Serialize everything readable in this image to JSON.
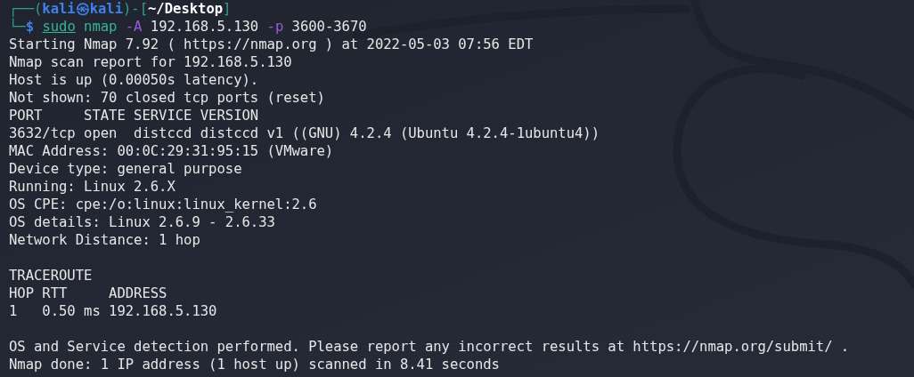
{
  "prompt": {
    "line1": [
      {
        "text": "┌──(",
        "kind": "frame"
      },
      {
        "text": "kali㉿kali",
        "kind": "user"
      },
      {
        "text": ")-[",
        "kind": "frame"
      },
      {
        "text": "~/Desktop",
        "kind": "path"
      },
      {
        "text": "]",
        "kind": "frame"
      }
    ],
    "line2": [
      {
        "text": "└─",
        "kind": "frame"
      },
      {
        "text": "$",
        "kind": "user"
      }
    ]
  },
  "command": [
    {
      "text": "sudo",
      "kind": "sudo"
    },
    {
      "text": "nmap",
      "kind": "program"
    },
    {
      "text": "-A",
      "kind": "option"
    },
    {
      "text": "192.168.5.130",
      "kind": "argument"
    },
    {
      "text": "-p",
      "kind": "option"
    },
    {
      "text": "3600-3670",
      "kind": "argument"
    }
  ],
  "output_blocks": [
    [
      "Starting Nmap 7.92 ( https://nmap.org ) at 2022-05-03 07:56 EDT",
      "Nmap scan report for 192.168.5.130",
      "Host is up (0.00050s latency).",
      "Not shown: 70 closed tcp ports (reset)",
      "PORT     STATE SERVICE VERSION",
      "3632/tcp open  distccd distccd v1 ((GNU) 4.2.4 (Ubuntu 4.2.4-1ubuntu4))",
      "MAC Address: 00:0C:29:31:95:15 (VMware)",
      "Device type: general purpose",
      "Running: Linux 2.6.X",
      "OS CPE: cpe:/o:linux:linux_kernel:2.6",
      "OS details: Linux 2.6.9 - 2.6.33",
      "Network Distance: 1 hop"
    ],
    [
      "TRACEROUTE",
      "HOP RTT     ADDRESS",
      "1   0.50 ms 192.168.5.130"
    ],
    [
      "OS and Service detection performed. Please report any incorrect results at https://nmap.org/submit/ .",
      "Nmap done: 1 IP address (1 host up) scanned in 8.41 seconds"
    ]
  ]
}
